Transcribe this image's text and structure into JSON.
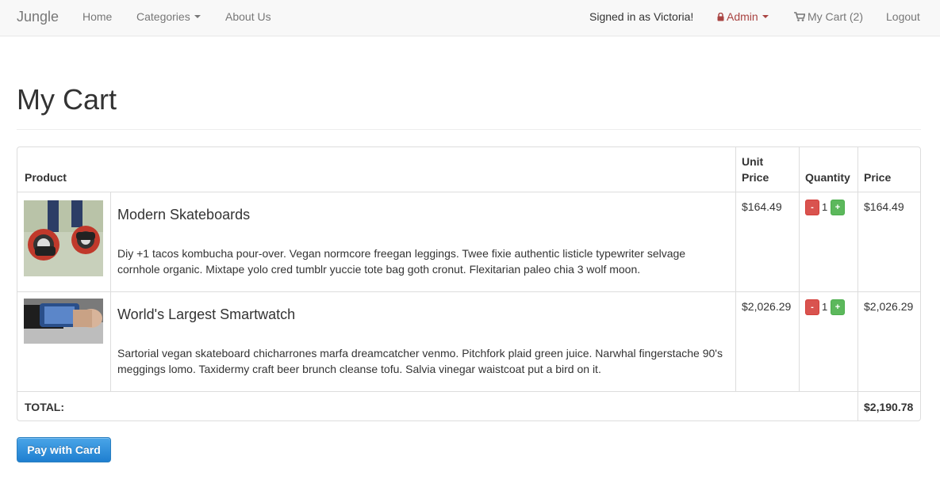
{
  "navbar": {
    "brand": "Jungle",
    "home": "Home",
    "categories": "Categories",
    "about": "About Us",
    "signed_in": "Signed in as Victoria!",
    "admin": "Admin",
    "cart": "My Cart (2)",
    "logout": "Logout"
  },
  "page": {
    "title": "My Cart"
  },
  "table": {
    "headers": {
      "product": "Product",
      "unit_price_line1": "Unit",
      "unit_price_line2": "Price",
      "quantity": "Quantity",
      "price": "Price"
    },
    "rows": [
      {
        "name": "Modern Skateboards",
        "description": "Diy +1 tacos kombucha pour-over. Vegan normcore freegan leggings. Twee fixie authentic listicle typewriter selvage cornhole organic. Mixtape yolo cred tumblr yuccie tote bag goth cronut. Flexitarian paleo chia 3 wolf moon.",
        "unit_price": "$164.49",
        "quantity": "1",
        "price": "$164.49",
        "minus": "-",
        "plus": "+"
      },
      {
        "name": "World's Largest Smartwatch",
        "description": "Sartorial vegan skateboard chicharrones marfa dreamcatcher venmo. Pitchfork plaid green juice. Narwhal fingerstache 90's meggings lomo. Taxidermy craft beer brunch cleanse tofu. Salvia vinegar waistcoat put a bird on it.",
        "unit_price": "$2,026.29",
        "quantity": "1",
        "price": "$2,026.29",
        "minus": "-",
        "plus": "+"
      }
    ],
    "total_label": "TOTAL:",
    "total_value": "$2,190.78"
  },
  "actions": {
    "pay": "Pay with Card"
  },
  "colors": {
    "danger": "#d9534f",
    "success": "#5cb85c",
    "admin": "#a94442",
    "primary": "#1f7fd0"
  }
}
